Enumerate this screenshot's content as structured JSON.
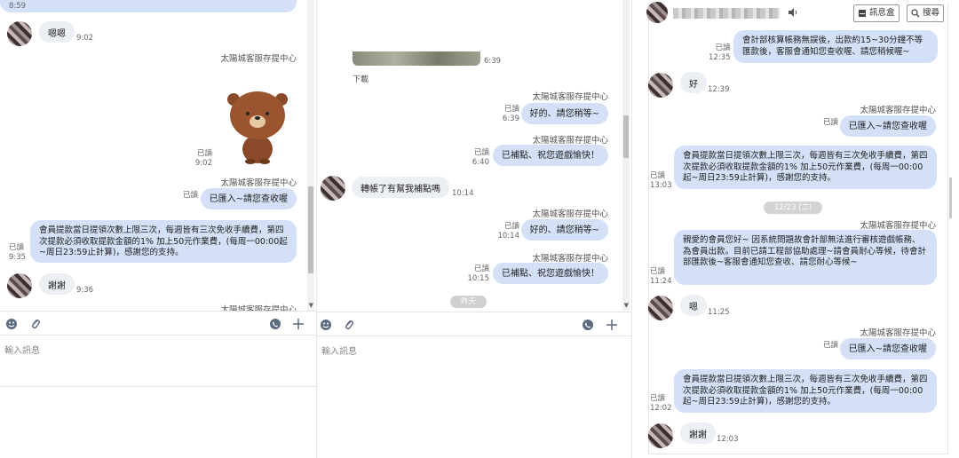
{
  "pane1": {
    "top_time": "8:59",
    "msg_in_1": {
      "text": "嗯嗯",
      "time": "9:02"
    },
    "sender_a": "太陽城客服存提中心",
    "sticker_meta": {
      "read": "已讀",
      "time": "9:02"
    },
    "sender_b": "太陽城客服存提中心",
    "msg_out_1": {
      "read": "已讀",
      "text": "已匯入~請您查收喔"
    },
    "msg_out_2": {
      "read": "已讀",
      "time": "9:35",
      "text": "會員提款當日提領次數上限三次，每週皆有三次免收手續費，第四次提款必須收取提款金額的1% 加上50元作業費，(每周一00:00起~周日23:59止計算)，感謝您的支持。"
    },
    "msg_in_2": {
      "text": "謝謝",
      "time": "9:36"
    },
    "sender_c": "太陽城客服存提中心",
    "input_placeholder": "輸入訊息"
  },
  "pane2": {
    "image_time": "6:39",
    "download_label": "下載",
    "sender_1": "太陽城客服存提中心",
    "msg_1": {
      "read": "已讀",
      "time": "6:39",
      "text": "好的、請您稍等~"
    },
    "sender_2": "太陽城客服存提中心",
    "msg_2": {
      "read": "已讀",
      "time": "6:40",
      "text": "已補點、祝您遊戲愉快！"
    },
    "msg_in": {
      "text": "轉帳了有幫我補點嗎",
      "time": "10:14"
    },
    "sender_3": "太陽城客服存提中心",
    "msg_3": {
      "read": "已讀",
      "time": "10:14",
      "text": "好的、請您稍等~"
    },
    "sender_4": "太陽城客服存提中心",
    "msg_4": {
      "read": "已讀",
      "time": "10:15",
      "text": "已補點、祝您遊戲愉快！"
    },
    "date_pill": "昨天",
    "input_placeholder": "輸入訊息"
  },
  "pane3": {
    "header": {
      "inbox_label": "訊息盒",
      "search_label": "搜尋"
    },
    "msg_top": {
      "read": "已讀",
      "time": "12:35",
      "text": "會計部核算帳務無誤後，出款約15~30分鐘不等匯款後，客服會通知您查收喔、請您稍候喔~"
    },
    "msg_in_1": {
      "text": "好",
      "time": "12:39"
    },
    "sender_1": "太陽城客服存提中心",
    "msg_1": {
      "read": "已讀",
      "text": "已匯入~請您查收喔"
    },
    "msg_2": {
      "read": "已讀",
      "time": "13:03",
      "text": "會員提款當日提領次數上限三次，每週皆有三次免收手續費，第四次提款必須收取提款金額的1% 加上50元作業費，(每周一00:00起~周日23:59止計算)，感謝您的支持。"
    },
    "date_pill": "12/23 (二)",
    "sender_2": "太陽城客服存提中心",
    "msg_3": {
      "read": "已讀",
      "time": "11:24",
      "text": "親愛的會員您好~ 因系統問題故會計部無法進行審核遊戲帳務、為會員出款。目前已請工程部協助處理~請會員耐心等候，待會計部匯款後~客服會通知您查收、請您耐心等候~"
    },
    "msg_in_2": {
      "text": "嗯",
      "time": "11:25"
    },
    "sender_3": "太陽城客服存提中心",
    "msg_4": {
      "read": "已讀",
      "text": "已匯入~請您查收喔"
    },
    "msg_5": {
      "read": "已讀",
      "time": "12:02",
      "text": "會員提款當日提領次數上限三次，每週皆有三次免收手續費，第四次提款必須收取提款金額的1% 加上50元作業費，(每周一00:00起~周日23:59止計算)，感謝您的支持。"
    },
    "msg_in_3": {
      "text": "謝謝",
      "time": "12:03"
    }
  },
  "colors": {
    "bubble_out": "#d4e0f7",
    "bubble_in": "#eceff3"
  }
}
